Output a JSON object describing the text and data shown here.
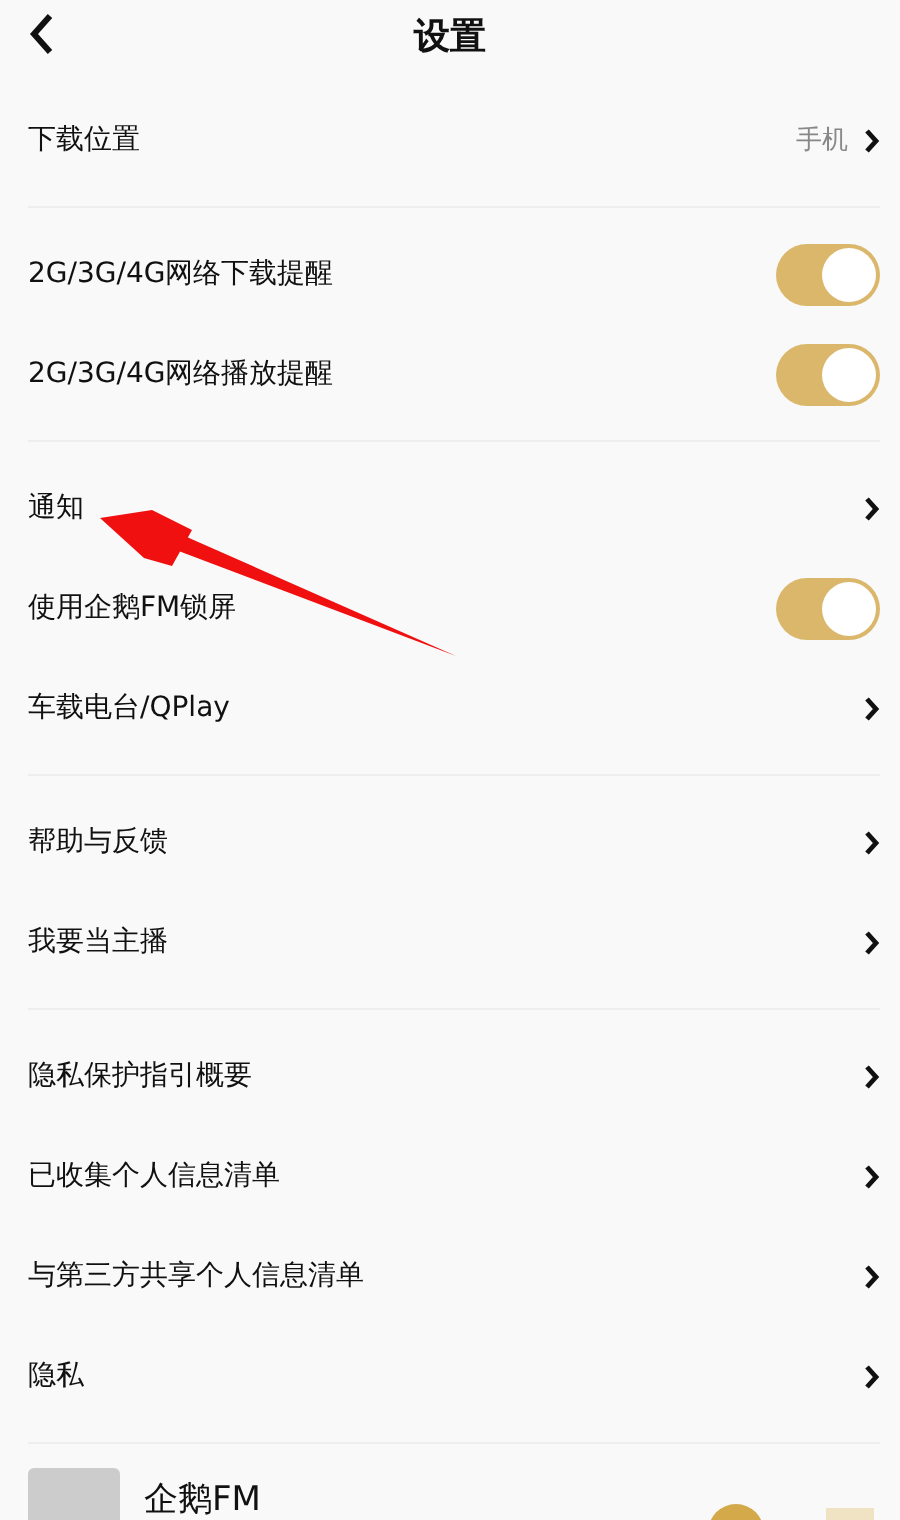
{
  "header": {
    "title": "设置"
  },
  "sections": [
    {
      "items": [
        {
          "kind": "link",
          "label": "下载位置",
          "value": "手机"
        }
      ]
    },
    {
      "items": [
        {
          "kind": "toggle",
          "label": "2G/3G/4G网络下载提醒",
          "on": true
        },
        {
          "kind": "toggle",
          "label": "2G/3G/4G网络播放提醒",
          "on": true
        }
      ]
    },
    {
      "items": [
        {
          "kind": "link",
          "label": "通知"
        },
        {
          "kind": "toggle",
          "label": "使用企鹅FM锁屏",
          "on": true
        },
        {
          "kind": "link",
          "label": "车载电台/QPlay"
        }
      ]
    },
    {
      "items": [
        {
          "kind": "link",
          "label": "帮助与反馈"
        },
        {
          "kind": "link",
          "label": "我要当主播"
        }
      ]
    },
    {
      "items": [
        {
          "kind": "link",
          "label": "隐私保护指引概要"
        },
        {
          "kind": "link",
          "label": "已收集个人信息清单"
        },
        {
          "kind": "link",
          "label": "与第三方共享个人信息清单"
        },
        {
          "kind": "link",
          "label": "隐私"
        }
      ]
    }
  ],
  "mini_player": {
    "title": "企鹅FM"
  }
}
